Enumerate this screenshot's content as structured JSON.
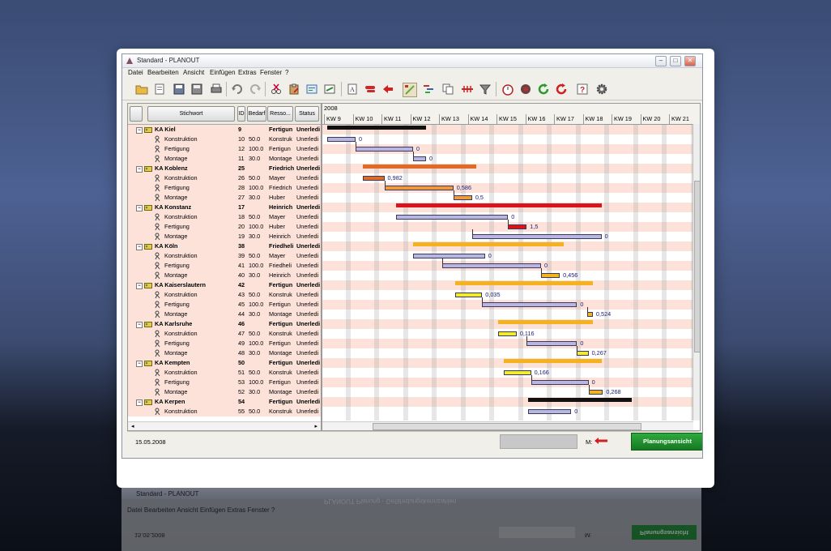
{
  "window": {
    "title": "Standard - PLANOUT"
  },
  "menu": [
    "Datei",
    "Bearbeiten",
    "Ansicht",
    "Einfügen",
    "Extras",
    "Fenster",
    "?"
  ],
  "toolbar_icons": [
    "open-folder-icon",
    "new-icon",
    "save-icon",
    "save-as-icon",
    "print-icon",
    "undo-icon",
    "redo-icon",
    "cut-icon",
    "paste-icon",
    "properties-icon",
    "text-icon",
    "link-icon",
    "arrow-left-icon",
    "gantt-edit-icon",
    "gantt-view-icon",
    "copy-icon",
    "critical-path-icon",
    "filter-icon",
    "timer-icon",
    "record-icon",
    "refresh-green-icon",
    "refresh-red-icon",
    "help-icon",
    "settings-icon"
  ],
  "grid": {
    "headers": {
      "name": "Stichwort",
      "id": "ID",
      "bedarf": "Bedarf",
      "ressource": "Resso...",
      "status": "Status"
    },
    "rows": [
      {
        "name": "KA Kiel",
        "id": "9",
        "bedarf": "",
        "res": "Fertigun",
        "status": "Unerledi",
        "parent": true
      },
      {
        "name": "Konstruktion",
        "id": "10",
        "bedarf": "50.0",
        "res": "Konstruk",
        "status": "Unerledi"
      },
      {
        "name": "Fertigung",
        "id": "12",
        "bedarf": "100.0",
        "res": "Fertigun",
        "status": "Unerledi"
      },
      {
        "name": "Montage",
        "id": "11",
        "bedarf": "30.0",
        "res": "Montage",
        "status": "Unerledi"
      },
      {
        "name": "KA Koblenz",
        "id": "25",
        "bedarf": "",
        "res": "Friedrich",
        "status": "Unerledi",
        "parent": true
      },
      {
        "name": "Konstruktion",
        "id": "26",
        "bedarf": "50.0",
        "res": "Mayer",
        "status": "Unerledi"
      },
      {
        "name": "Fertigung",
        "id": "28",
        "bedarf": "100.0",
        "res": "Friedrich",
        "status": "Unerledi"
      },
      {
        "name": "Montage",
        "id": "27",
        "bedarf": "30.0",
        "res": "Huber",
        "status": "Unerledi"
      },
      {
        "name": "KA Konstanz",
        "id": "17",
        "bedarf": "",
        "res": "Heinrich",
        "status": "Unerledi",
        "parent": true
      },
      {
        "name": "Konstruktion",
        "id": "18",
        "bedarf": "50.0",
        "res": "Mayer",
        "status": "Unerledi"
      },
      {
        "name": "Fertigung",
        "id": "20",
        "bedarf": "100.0",
        "res": "Huber",
        "status": "Unerledi"
      },
      {
        "name": "Montage",
        "id": "19",
        "bedarf": "30.0",
        "res": "Heinrich",
        "status": "Unerledi"
      },
      {
        "name": "KA Köln",
        "id": "38",
        "bedarf": "",
        "res": "Friedheli",
        "status": "Unerledi",
        "parent": true
      },
      {
        "name": "Konstruktion",
        "id": "39",
        "bedarf": "50.0",
        "res": "Mayer",
        "status": "Unerledi"
      },
      {
        "name": "Fertigung",
        "id": "41",
        "bedarf": "100.0",
        "res": "Friedheli",
        "status": "Unerledi"
      },
      {
        "name": "Montage",
        "id": "40",
        "bedarf": "30.0",
        "res": "Heinrich",
        "status": "Unerledi"
      },
      {
        "name": "KA Kaiserslautern",
        "id": "42",
        "bedarf": "",
        "res": "Fertigun",
        "status": "Unerledi",
        "parent": true
      },
      {
        "name": "Konstruktion",
        "id": "43",
        "bedarf": "50.0",
        "res": "Konstruk",
        "status": "Unerledi"
      },
      {
        "name": "Fertigung",
        "id": "45",
        "bedarf": "100.0",
        "res": "Fertigun",
        "status": "Unerledi"
      },
      {
        "name": "Montage",
        "id": "44",
        "bedarf": "30.0",
        "res": "Montage",
        "status": "Unerledi"
      },
      {
        "name": "KA Karlsruhe",
        "id": "46",
        "bedarf": "",
        "res": "Fertigun",
        "status": "Unerledi",
        "parent": true
      },
      {
        "name": "Konstruktion",
        "id": "47",
        "bedarf": "50.0",
        "res": "Konstruk",
        "status": "Unerledi"
      },
      {
        "name": "Fertigung",
        "id": "49",
        "bedarf": "100.0",
        "res": "Fertigun",
        "status": "Unerledi"
      },
      {
        "name": "Montage",
        "id": "48",
        "bedarf": "30.0",
        "res": "Montage",
        "status": "Unerledi"
      },
      {
        "name": "KA Kempten",
        "id": "50",
        "bedarf": "",
        "res": "Fertigun",
        "status": "Unerledi",
        "parent": true
      },
      {
        "name": "Konstruktion",
        "id": "51",
        "bedarf": "50.0",
        "res": "Konstruk",
        "status": "Unerledi"
      },
      {
        "name": "Fertigung",
        "id": "53",
        "bedarf": "100.0",
        "res": "Fertigun",
        "status": "Unerledi"
      },
      {
        "name": "Montage",
        "id": "52",
        "bedarf": "30.0",
        "res": "Montage",
        "status": "Unerledi"
      },
      {
        "name": "KA Kerpen",
        "id": "54",
        "bedarf": "",
        "res": "Fertigun",
        "status": "Unerledi",
        "parent": true
      },
      {
        "name": "Konstruktion",
        "id": "55",
        "bedarf": "50.0",
        "res": "Konstruk",
        "status": "Unerledi"
      }
    ]
  },
  "gantt": {
    "year": "2008",
    "weeks": [
      "KW 9",
      "KW 10",
      "KW 11",
      "KW 12",
      "KW 13",
      "KW 14",
      "KW 15",
      "KW 16",
      "KW 17",
      "KW 18",
      "KW 19",
      "KW 20",
      "KW 21"
    ],
    "tasks": [
      {
        "row": 0,
        "start": 0.1,
        "end": 3.55,
        "kind": "summary",
        "color": "#111111"
      },
      {
        "row": 1,
        "start": 0.1,
        "end": 1.1,
        "kind": "task",
        "color": "#b9b6e4",
        "label": "0"
      },
      {
        "row": 2,
        "start": 1.1,
        "end": 3.1,
        "kind": "task",
        "color": "#b9b6e4",
        "label": "0"
      },
      {
        "row": 3,
        "start": 3.1,
        "end": 3.55,
        "kind": "task",
        "color": "#b9b6e4",
        "label": "0"
      },
      {
        "row": 4,
        "start": 1.35,
        "end": 5.3,
        "kind": "summary",
        "color": "#e06a28"
      },
      {
        "row": 5,
        "start": 1.35,
        "end": 2.1,
        "kind": "task",
        "color": "#e06a28",
        "label": "0,982"
      },
      {
        "row": 6,
        "start": 2.1,
        "end": 4.5,
        "kind": "task",
        "color": "#ee9a42",
        "label": "0,586"
      },
      {
        "row": 7,
        "start": 4.5,
        "end": 5.15,
        "kind": "task",
        "color": "#ee9a42",
        "label": "0,5"
      },
      {
        "row": 8,
        "start": 2.5,
        "end": 9.65,
        "kind": "summary",
        "color": "#d8141c"
      },
      {
        "row": 9,
        "start": 2.5,
        "end": 6.4,
        "kind": "task",
        "color": "#b9b6e4",
        "label": "0"
      },
      {
        "row": 10,
        "start": 6.4,
        "end": 7.05,
        "kind": "task",
        "color": "#d8141c",
        "label": "1,5"
      },
      {
        "row": 11,
        "start": 5.15,
        "end": 9.65,
        "kind": "task",
        "color": "#b9b6e4",
        "label": "0"
      },
      {
        "row": 12,
        "start": 3.1,
        "end": 8.35,
        "kind": "summary",
        "color": "#f3b21e"
      },
      {
        "row": 13,
        "start": 3.1,
        "end": 5.6,
        "kind": "task",
        "color": "#b9b6e4",
        "label": "0"
      },
      {
        "row": 14,
        "start": 4.1,
        "end": 7.55,
        "kind": "task",
        "color": "#b9b6e4",
        "label": "0"
      },
      {
        "row": 15,
        "start": 7.55,
        "end": 8.2,
        "kind": "task",
        "color": "#f3b21e",
        "label": "0,456"
      },
      {
        "row": 16,
        "start": 4.55,
        "end": 9.35,
        "kind": "summary",
        "color": "#f3b21e"
      },
      {
        "row": 17,
        "start": 4.55,
        "end": 5.5,
        "kind": "task",
        "color": "#f4ea30",
        "label": "0,035"
      },
      {
        "row": 18,
        "start": 5.5,
        "end": 8.8,
        "kind": "task",
        "color": "#b9b6e4",
        "label": "0"
      },
      {
        "row": 19,
        "start": 9.15,
        "end": 9.35,
        "kind": "task",
        "color": "#f3b21e",
        "label": "0,524"
      },
      {
        "row": 20,
        "start": 6.05,
        "end": 9.35,
        "kind": "summary",
        "color": "#f3b21e"
      },
      {
        "row": 21,
        "start": 6.05,
        "end": 6.7,
        "kind": "task",
        "color": "#f4ea30",
        "label": "0,116"
      },
      {
        "row": 22,
        "start": 7.05,
        "end": 8.8,
        "kind": "task",
        "color": "#b9b6e4",
        "label": "0"
      },
      {
        "row": 23,
        "start": 8.8,
        "end": 9.2,
        "kind": "task",
        "color": "#f4ea30",
        "label": "0,267"
      },
      {
        "row": 24,
        "start": 6.25,
        "end": 9.65,
        "kind": "summary",
        "color": "#f3b21e"
      },
      {
        "row": 25,
        "start": 6.25,
        "end": 7.2,
        "kind": "task",
        "color": "#f4ea30",
        "label": "0,166"
      },
      {
        "row": 26,
        "start": 7.2,
        "end": 9.2,
        "kind": "task",
        "color": "#b9b6e4",
        "label": "0"
      },
      {
        "row": 27,
        "start": 9.2,
        "end": 9.7,
        "kind": "task",
        "color": "#f3b21e",
        "label": "0,268"
      },
      {
        "row": 28,
        "start": 7.1,
        "end": 10.7,
        "kind": "summary",
        "color": "#111111"
      },
      {
        "row": 29,
        "start": 7.1,
        "end": 8.6,
        "kind": "task",
        "color": "#b9b6e4",
        "label": "0"
      }
    ]
  },
  "status": {
    "date": "15.05.2008",
    "m_label": "M:",
    "planungsansicht": "Planungsansicht"
  },
  "reflection": {
    "caption": "PLANOUT Planung - Gefährdungskennzahlen"
  }
}
